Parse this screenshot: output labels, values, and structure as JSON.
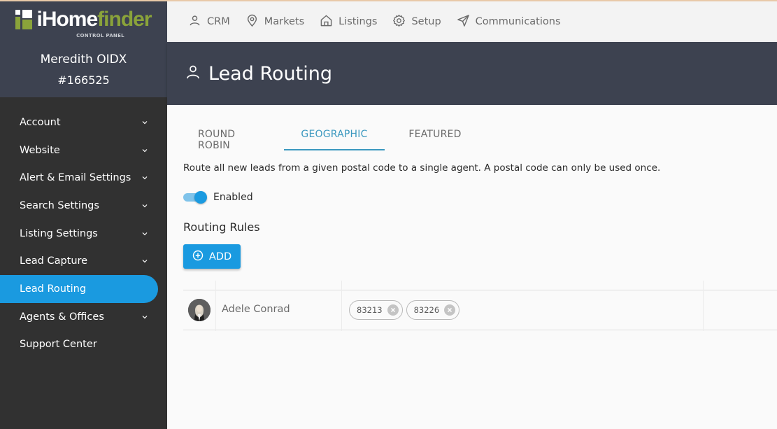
{
  "brand": {
    "name_white": "iHome",
    "name_green": "finder",
    "subtitle": "CONTROL PANEL",
    "green": "#8aa33a"
  },
  "account": {
    "name": "Meredith OIDX",
    "id": "#166525"
  },
  "sidebar": {
    "items": [
      {
        "label": "Account",
        "has_chevron": true
      },
      {
        "label": "Website",
        "has_chevron": true
      },
      {
        "label": "Alert & Email Settings",
        "has_chevron": true
      },
      {
        "label": "Search Settings",
        "has_chevron": true
      },
      {
        "label": "Listing Settings",
        "has_chevron": true
      },
      {
        "label": "Lead Capture",
        "has_chevron": true
      },
      {
        "label": "Lead Routing",
        "has_chevron": false,
        "active": true
      },
      {
        "label": "Agents & Offices",
        "has_chevron": true
      },
      {
        "label": "Support Center",
        "has_chevron": false
      }
    ],
    "active_color": "#1a9ae0"
  },
  "topnav": {
    "items": [
      {
        "label": "CRM",
        "icon": "user-icon"
      },
      {
        "label": "Markets",
        "icon": "map-pin-icon"
      },
      {
        "label": "Listings",
        "icon": "home-icon"
      },
      {
        "label": "Setup",
        "icon": "gear-icon"
      },
      {
        "label": "Communications",
        "icon": "send-icon"
      }
    ]
  },
  "page": {
    "title": "Lead Routing",
    "title_icon": "user-icon"
  },
  "tabs": [
    {
      "label": "ROUND ROBIN",
      "active": false
    },
    {
      "label": "GEOGRAPHIC",
      "active": true
    },
    {
      "label": "FEATURED",
      "active": false
    }
  ],
  "geographic": {
    "description": "Route all new leads from a given postal code to a single agent. A postal code can only be used once.",
    "toggle": {
      "label": "Enabled",
      "on": true
    },
    "section_title": "Routing Rules",
    "add_button": "ADD",
    "rules": [
      {
        "agent": "Adele Conrad",
        "postal_codes": [
          "83213",
          "83226"
        ]
      }
    ]
  }
}
